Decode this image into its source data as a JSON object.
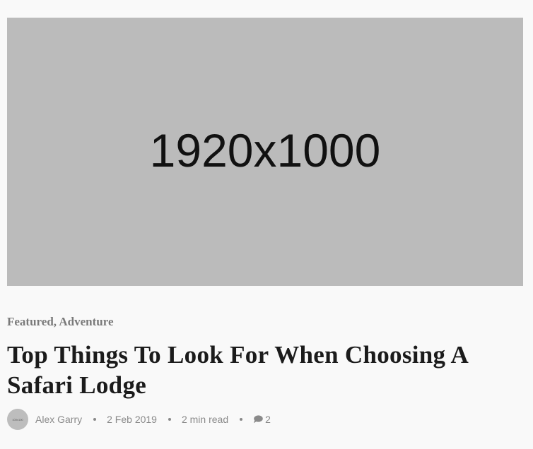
{
  "post": {
    "image_placeholder": "1920x1000",
    "categories": [
      "Featured",
      "Adventure"
    ],
    "category_separator": ", ",
    "title": "Top Things To Look For When Choosing A Safari Lodge",
    "author": {
      "avatar_text": "100x100",
      "name": "Alex Garry"
    },
    "date": "2 Feb 2019",
    "read_time": "2 min read",
    "comment_count": "2",
    "comment_icon": "comment-icon"
  },
  "colors": {
    "background": "#f9f9f9",
    "image_placeholder": "#bbbbbb",
    "title": "#1b1b1b",
    "muted_text": "#8a8a8a"
  }
}
